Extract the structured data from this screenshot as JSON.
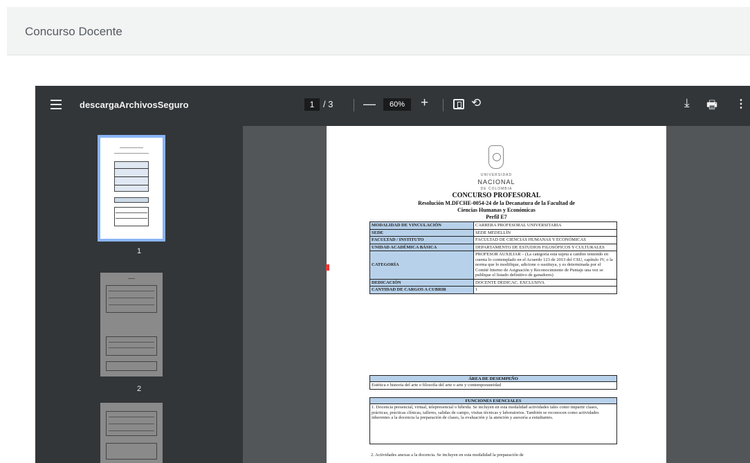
{
  "page": {
    "title": "Concurso Docente"
  },
  "viewer": {
    "filename": "descargaArchivosSeguro",
    "current_page": "1",
    "page_separator": "/ 3",
    "zoom": "60%",
    "icons": {
      "menu": "menu-icon",
      "zoom_out": "minus-icon",
      "zoom_in": "plus-icon",
      "fit": "fit-page-icon",
      "rotate": "rotate-icon",
      "download": "download-icon",
      "print": "print-icon",
      "more": "more-vert-icon"
    },
    "glyphs": {
      "minus": "—",
      "plus": "+",
      "rotate": "⟲",
      "download": "⤓",
      "print": "🖶",
      "more": "⋮"
    },
    "thumbnails": [
      {
        "label": "1"
      },
      {
        "label": "2"
      }
    ]
  },
  "document": {
    "logo_top": "UNIVERSIDAD",
    "logo_main": "NACIONAL",
    "logo_bottom": "DE COLOMBIA",
    "title": "CONCURSO PROFESORAL",
    "resolution": "Resolución M.DFCHE-0054-24 de la Decanatura de la Facultad de",
    "resolution_2": "Ciencias Humanas y Económicas",
    "profile": "Perfil E7",
    "rows": [
      {
        "key": "MODALIDAD DE VINCULACIÓN",
        "value": "CARRERA PROFESORAL UNIVERSITARIA"
      },
      {
        "key": "SEDE",
        "value": "SEDE MEDELLÍN"
      },
      {
        "key": "FACULTAD / INSTITUTO",
        "value": "FACULTAD DE CIENCIAS HUMANAS Y ECONÓMICAS"
      },
      {
        "key": "UNIDAD ACADÉMICA BÁSICA",
        "value": "DEPARTAMENTO DE ESTUDIOS FILOSÓFICOS Y CULTURALES"
      },
      {
        "key": "CATEGORÍA",
        "value": "PROFESOR AUXILIAR – (La categoría está sujeta a cambio teniendo en cuenta lo contemplado en el Acuerdo 123 de 2013 del CSU, capítulo IV, o la norma que lo modifique, adicione o sustituya, y es determinada por el Comité Interno de Asignación y Reconocimiento de Puntaje una vez se publique el listado definitivo de ganadores)"
      },
      {
        "key": "DEDICACIÓN",
        "value": "DOCENTE DEDICAC. EXCLUSIVA"
      },
      {
        "key": "CANTIDAD DE CARGOS A CUBRIR",
        "value": "1"
      }
    ],
    "area_heading": "ÁREA DE DESEMPEÑO",
    "area_text": "Estética e historia del arte o filosofía del arte o arte y contemporaneidad",
    "functions_heading": "FUNCIONES ESENCIALES",
    "functions_text": "1. Docencia presencial, virtual, telepresencial o híbrida. Se incluyen en esta modalidad actividades tales como impartir clases, prácticas, prácticas clínicas, talleres, salidas de campo, visitas técnicas y laboratorios. También se reconocen como actividades inherentes a la docencia la preparación de clases, la evaluación y la atención y asesoría a estudiantes.",
    "functions_text_2": "2. Actividades anexas a la docencia. Se incluyen en esta modalidad la preparación de"
  }
}
